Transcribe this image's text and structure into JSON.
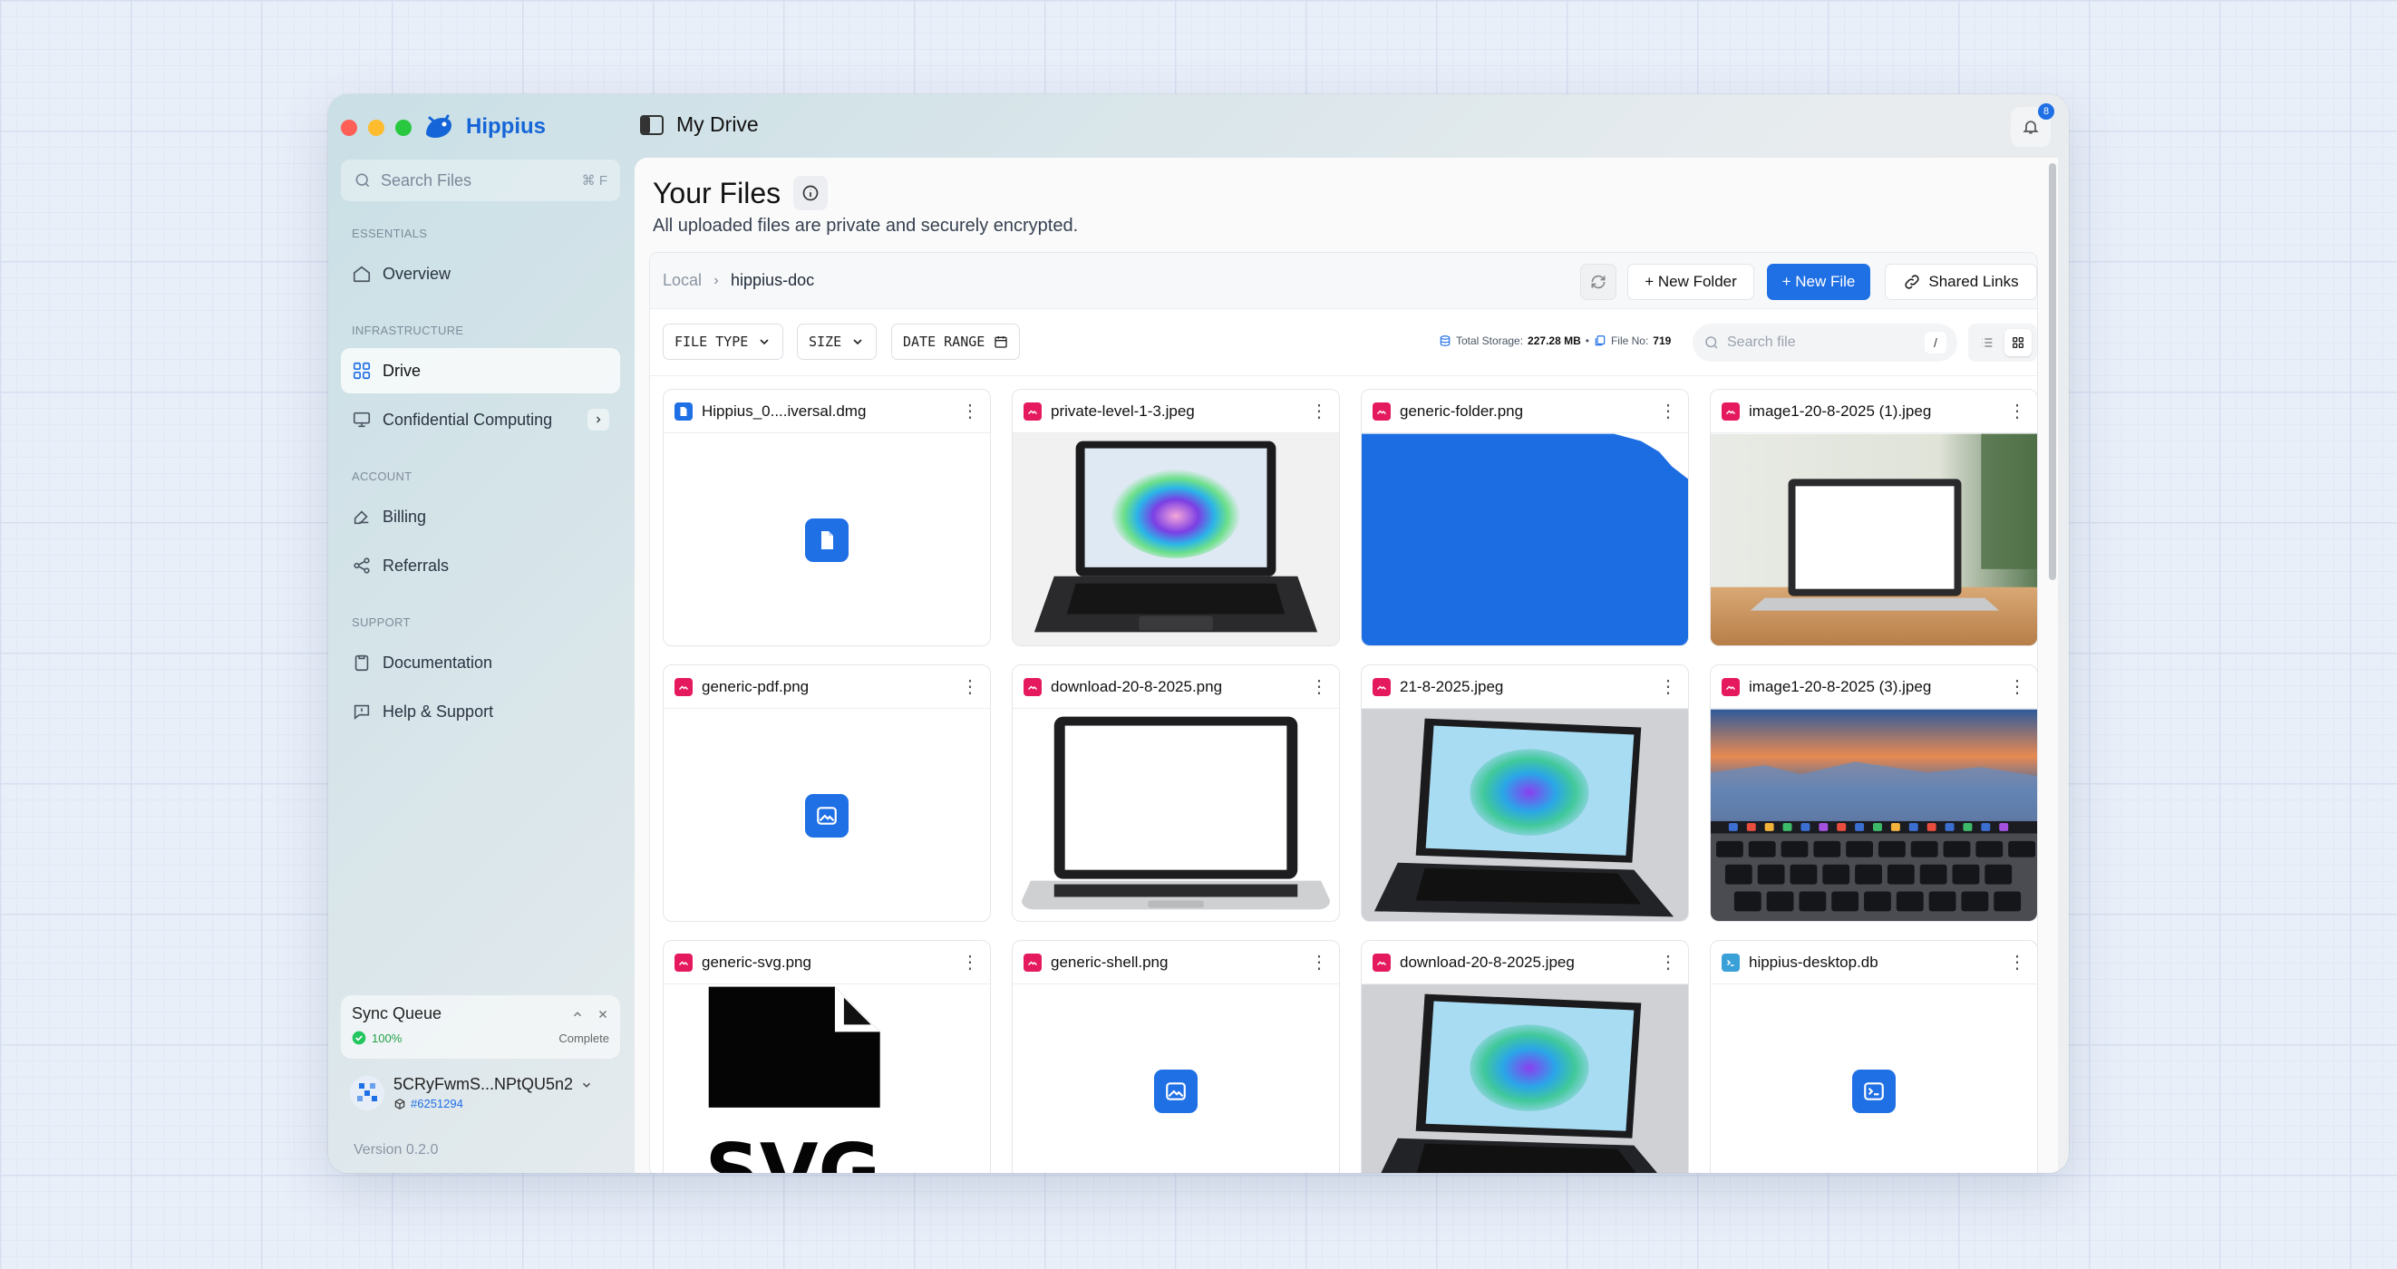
{
  "app": {
    "name": "Hippius",
    "page_title": "My Drive",
    "notif_count": "8"
  },
  "sidebar": {
    "search_placeholder": "Search Files",
    "search_shortcut": "⌘ F",
    "sections": {
      "essentials": "ESSENTIALS",
      "infrastructure": "INFRASTRUCTURE",
      "account": "ACCOUNT",
      "support": "SUPPORT"
    },
    "items": [
      {
        "label": "Overview"
      },
      {
        "label": "Drive"
      },
      {
        "label": "Confidential Computing"
      },
      {
        "label": "Billing"
      },
      {
        "label": "Referrals"
      },
      {
        "label": "Documentation"
      },
      {
        "label": "Help & Support"
      }
    ],
    "sync": {
      "title": "Sync Queue",
      "percent": "100%",
      "status": "Complete"
    },
    "account": {
      "address": "5CRyFwmS...NPtQU5n2",
      "id": "#6251294"
    },
    "version": "Version 0.2.0"
  },
  "main": {
    "title": "Your Files",
    "subtitle": "All uploaded files are private and securely encrypted.",
    "breadcrumb": [
      "Local",
      "hippius-doc"
    ],
    "buttons": {
      "new_folder": "+ New Folder",
      "new_file": "+ New File",
      "shared_links": "Shared Links"
    },
    "filters": {
      "file_type": "FILE TYPE",
      "size": "SIZE",
      "date_range": "DATE RANGE"
    },
    "storage": {
      "label": "Total Storage:",
      "value": "227.28 MB",
      "file_label": "File No:",
      "file_count": "719"
    },
    "search_placeholder": "Search file",
    "search_shortcut": "/",
    "files": [
      {
        "name": "Hippius_0....iversal.dmg",
        "kind": "doc"
      },
      {
        "name": "private-level-1-3.jpeg",
        "kind": "image"
      },
      {
        "name": "generic-folder.png",
        "kind": "image"
      },
      {
        "name": "image1-20-8-2025 (1).jpeg",
        "kind": "image"
      },
      {
        "name": "generic-pdf.png",
        "kind": "image"
      },
      {
        "name": "download-20-8-2025.png",
        "kind": "image"
      },
      {
        "name": "21-8-2025.jpeg",
        "kind": "image"
      },
      {
        "name": "image1-20-8-2025 (3).jpeg",
        "kind": "image"
      },
      {
        "name": "generic-svg.png",
        "kind": "image"
      },
      {
        "name": "generic-shell.png",
        "kind": "image"
      },
      {
        "name": "download-20-8-2025.jpeg",
        "kind": "image"
      },
      {
        "name": "hippius-desktop.db",
        "kind": "code"
      }
    ]
  },
  "colors": {
    "accent": "#1f6fe5",
    "image_type": "#e5195e",
    "code_type": "#3aa0d8"
  }
}
